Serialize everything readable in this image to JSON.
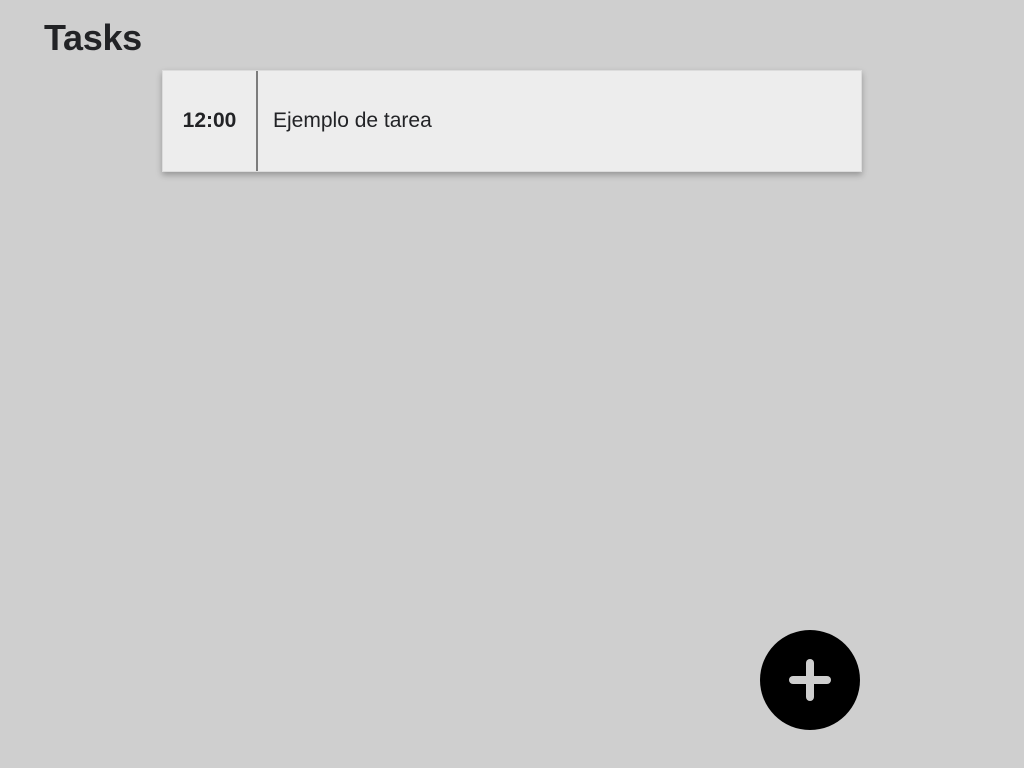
{
  "header": {
    "title": "Tasks"
  },
  "tasks": [
    {
      "time": "12:00",
      "title": "Ejemplo de tarea"
    }
  ],
  "fab": {
    "icon": "plus-icon",
    "background": "#000000",
    "icon_color": "#cfcfcf"
  },
  "colors": {
    "page_background": "#cfcfcf",
    "card_background": "#ededed",
    "divider": "#7c7c7c",
    "text": "#222326"
  }
}
